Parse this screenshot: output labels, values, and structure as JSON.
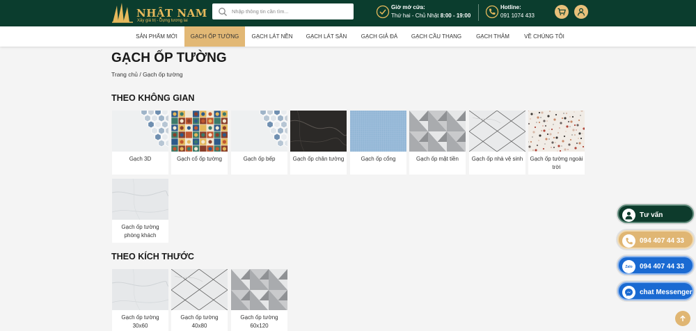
{
  "header": {
    "logo_name": "NHẬT NAM",
    "logo_tagline": "Xây giá trị - Dựng tương lai",
    "search_placeholder": "Nhập thông tin cần tìm...",
    "hours_title": "Giờ mở cửa:",
    "hours_text_prefix": "Thứ hai - Chủ Nhật ",
    "hours_text_time": "8:00 - 19:00",
    "hotline_title": "Hotline:",
    "hotline_number": "091 1074 433",
    "colors": {
      "bar": "#0b3d2e",
      "accent": "#e2b875"
    }
  },
  "nav": {
    "items": [
      {
        "label": "SẢN PHẨM MỚI"
      },
      {
        "label": "GẠCH ỐP TƯỜNG",
        "active": true
      },
      {
        "label": "GẠCH LÁT NỀN"
      },
      {
        "label": "GẠCH LÁT SÂN"
      },
      {
        "label": "GẠCH GIẢ ĐÁ"
      },
      {
        "label": "GẠCH CẦU THANG"
      },
      {
        "label": "GẠCH THẢM"
      },
      {
        "label": "VỀ CHÚNG TÔI"
      }
    ]
  },
  "page": {
    "title": "GẠCH ỐP TƯỜNG",
    "breadcrumb_home": "Trang chủ",
    "breadcrumb_sep": " / ",
    "breadcrumb_current": "Gạch ốp tường"
  },
  "sections": [
    {
      "title": "THEO KHÔNG GIAN",
      "items": [
        {
          "label": "Gạch 3D",
          "pattern": "hex"
        },
        {
          "label": "Gạch cổ ốp tường",
          "pattern": "mosaic"
        },
        {
          "label": "Gạch ốp bếp",
          "pattern": "hex"
        },
        {
          "label": "Gạch ốp chân tường",
          "pattern": "dark-marble"
        },
        {
          "label": "Gạch ốp cổng",
          "pattern": "blue-grid"
        },
        {
          "label": "Gạch ốp mặt tiền",
          "pattern": "gray-triangles"
        },
        {
          "label": "Gạch ốp nhà vệ sinh",
          "pattern": "marble-diagonal"
        },
        {
          "label": "Gạch ốp tường ngoài trời",
          "pattern": "terrazzo"
        },
        {
          "label": "Gạch ốp tường phòng khách",
          "pattern": "white-marble"
        }
      ]
    },
    {
      "title": "THEO KÍCH THƯỚC",
      "items": [
        {
          "label": "Gạch ốp tường 30x60",
          "pattern": "white-marble"
        },
        {
          "label": "Gạch ốp tường 40x80",
          "pattern": "marble-diagonal"
        },
        {
          "label": "Gạch ốp tường 60x120",
          "pattern": "gray-triangles"
        }
      ]
    }
  ],
  "floating": {
    "consult": "Tư vấn",
    "phone": "094 407 44 33",
    "zalo": "094 407 44 33",
    "zalo_icon_text": "Zalo",
    "messenger": "chat Messenger"
  }
}
